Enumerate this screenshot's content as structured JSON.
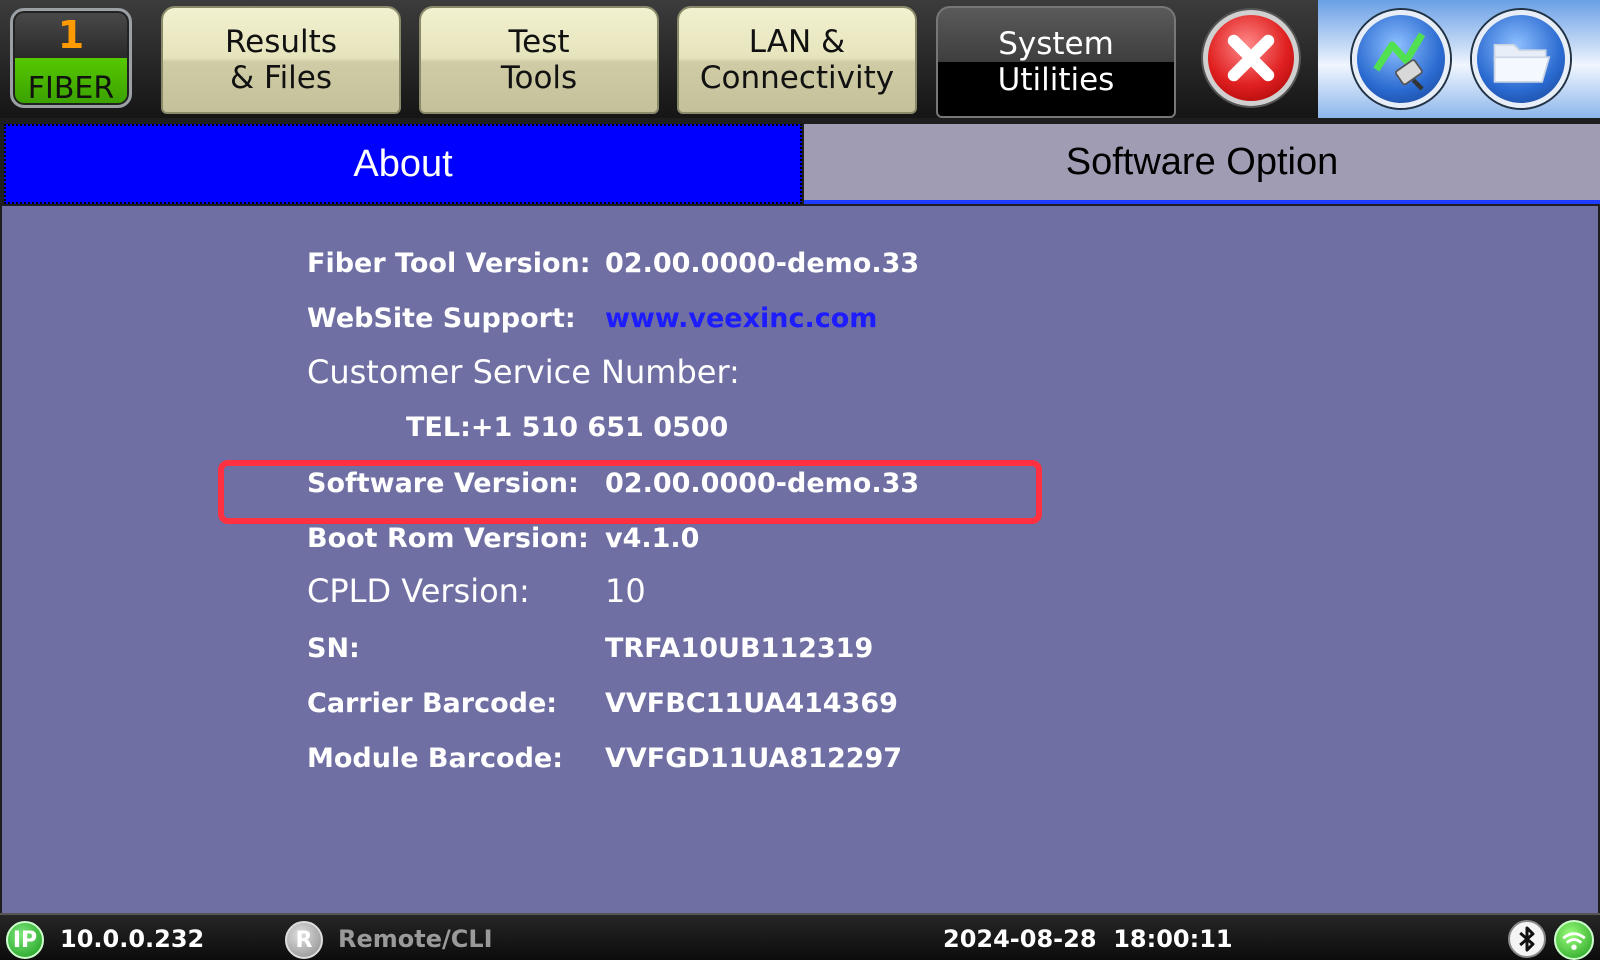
{
  "header": {
    "fiber_number": "1",
    "fiber_label": "FIBER",
    "tabs": [
      {
        "label": "Results\n& Files"
      },
      {
        "label": "Test\nTools"
      },
      {
        "label": "LAN &\nConnectivity"
      },
      {
        "label": "System\nUtilities",
        "active": true
      }
    ],
    "icons": [
      "close-icon",
      "network-connection-icon",
      "open-folder-icon"
    ]
  },
  "subtabs": {
    "about": "About",
    "software_option": "Software Option"
  },
  "about": {
    "fiber_tool_version": {
      "label": "Fiber Tool Version:",
      "value": "02.00.0000-demo.33"
    },
    "website_support": {
      "label": "WebSite Support:",
      "value": "www.veexinc.com"
    },
    "customer_service": {
      "label": "Customer Service Number:",
      "tel": "TEL:+1 510 651 0500"
    },
    "software_version": {
      "label": "Software Version:",
      "value": "02.00.0000-demo.33"
    },
    "boot_rom_version": {
      "label": "Boot Rom Version:",
      "value": "v4.1.0"
    },
    "cpld_version": {
      "label": "CPLD Version:",
      "value": "10"
    },
    "sn": {
      "label": "SN:",
      "value": "TRFA10UB112319"
    },
    "carrier_barcode": {
      "label": "Carrier Barcode:",
      "value": "VVFBC11UA414369"
    },
    "module_barcode": {
      "label": "Module Barcode:",
      "value": "VVFGD11UA812297"
    }
  },
  "status": {
    "ip_badge": "IP",
    "ip_address": "10.0.0.232",
    "remote_badge": "R",
    "remote_label": "Remote/CLI",
    "datetime": "2024-08-28  18:00:11",
    "icons": [
      "bluetooth-icon",
      "wifi-icon"
    ]
  },
  "colors": {
    "about_tab": "#0000ff",
    "content_bg": "#6f6fa4",
    "highlight": "#ff3040",
    "link": "#1c1cff"
  }
}
